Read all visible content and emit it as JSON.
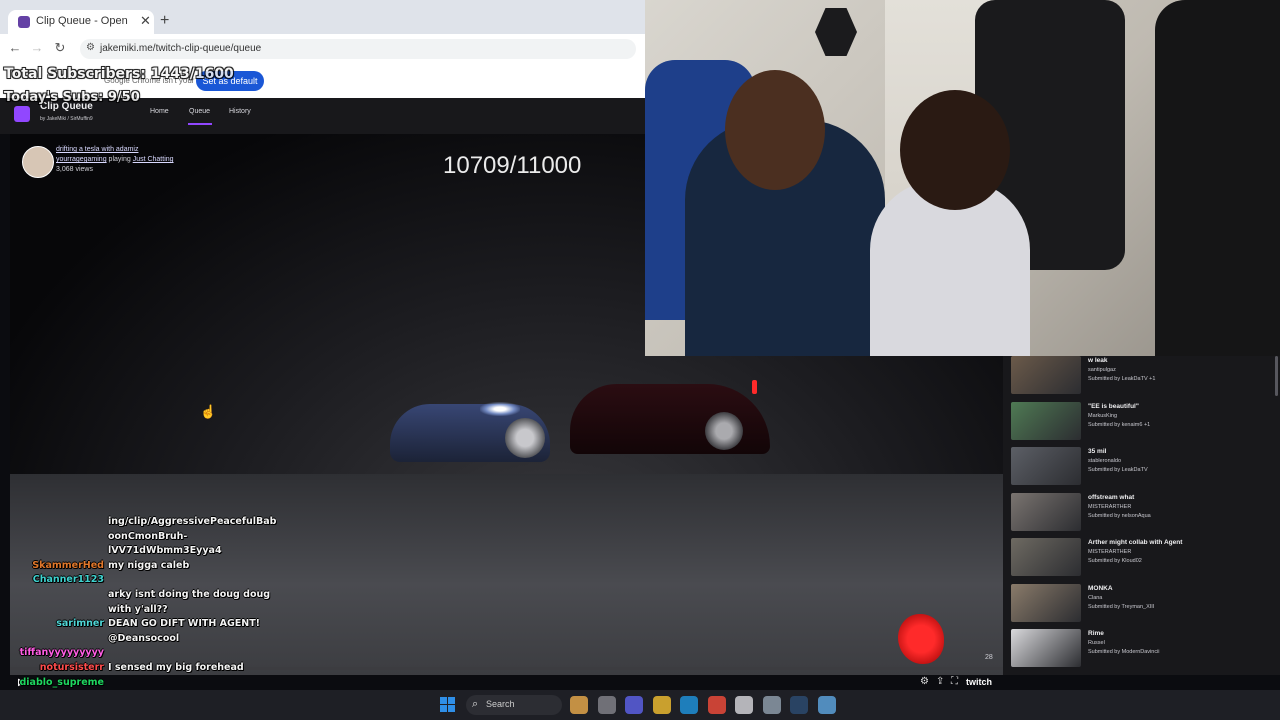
{
  "browser": {
    "tab_title": "Clip Queue - Open",
    "url": "jakemiki.me/twitch-clip-queue/queue",
    "default_message": "Google Chrome isn't your default browser",
    "default_button": "Set as default"
  },
  "overlay": {
    "subs_total": "Total Subscribers: 1443/1600",
    "subs_today": "Today's Subs: 9/50",
    "counter": "10709/11000"
  },
  "app": {
    "title": "Clip Queue",
    "credits": "by JakeMiki / SirMuffin9",
    "nav": [
      "Home",
      "Queue",
      "History"
    ]
  },
  "clip": {
    "title": "drifting a tesla with adamiz",
    "channel": "yourragegaming",
    "playing_word": "playing",
    "category": "Just Chatting",
    "views": "3,068 views",
    "timestamp": "28",
    "progress_fraction": 0.0
  },
  "chat": [
    {
      "user": "",
      "message": "ing/clip/AggressivePeacefulBab",
      "color": "#f4f4f4"
    },
    {
      "user": "",
      "message": "oonCmonBruh-",
      "color": "#f4f4f4"
    },
    {
      "user": "",
      "message": "lVV71dWbmm3Eyya4",
      "color": "#f4f4f4"
    },
    {
      "user": "SkammerHed",
      "message": "my nigga caleb",
      "color": "#e0772b"
    },
    {
      "user": "Channer1123",
      "message": "",
      "color": "#3fd3d0"
    },
    {
      "user": "",
      "message": "arky isnt doing the doug doug",
      "color": "#ff3a3a"
    },
    {
      "user": "",
      "message": "with y'all??",
      "color": "#f4f4f4"
    },
    {
      "user": "sarimner",
      "message": "DEAN GO DIFT WITH AGENT!",
      "color": "#4fd6d6"
    },
    {
      "user": "",
      "message": "@Deansocool",
      "color": "#f4f4f4"
    },
    {
      "user": "tiffanyyyyyyyyy",
      "message": "",
      "color": "#ff5de3"
    },
    {
      "user": "notursisterr",
      "message": "I sensed my big forehead",
      "color": "#ff4d4d"
    },
    {
      "user": "diablo_supreme",
      "message": "",
      "color": "#1ed760"
    }
  ],
  "queue": [
    {
      "title": "w leak",
      "channel": "santipulgaz",
      "submitted": "Submitted by LeakDaTV +1"
    },
    {
      "title": "\"EE is beautiful\"",
      "channel": "MarkusKing",
      "submitted": "Submitted by kenaim6 +1"
    },
    {
      "title": "35 mil",
      "channel": "stableronaldo",
      "submitted": "Submitted by LeakDaTV"
    },
    {
      "title": "offstream what",
      "channel": "MISTERARTHER",
      "submitted": "Submitted by nelsonAqua"
    },
    {
      "title": "Arther might collab with Agent",
      "channel": "MISTERARTHER",
      "submitted": "Submitted by Kloud02"
    },
    {
      "title": "MONKA",
      "channel": "Clana",
      "submitted": "Submitted by Treyman_XIII"
    },
    {
      "title": "Rime",
      "channel": "Russel",
      "submitted": "Submitted by ModernDavincii"
    }
  ],
  "taskbar": {
    "search_label": "Search",
    "apps": [
      "widgets",
      "file-manager",
      "chat",
      "folder",
      "edge",
      "chrome",
      "obs",
      "settings",
      "steam",
      "app"
    ]
  },
  "colors": {
    "twitch_purple": "#9147ff",
    "chrome_blue": "#1a57d6",
    "panel_dark": "#18181b"
  }
}
